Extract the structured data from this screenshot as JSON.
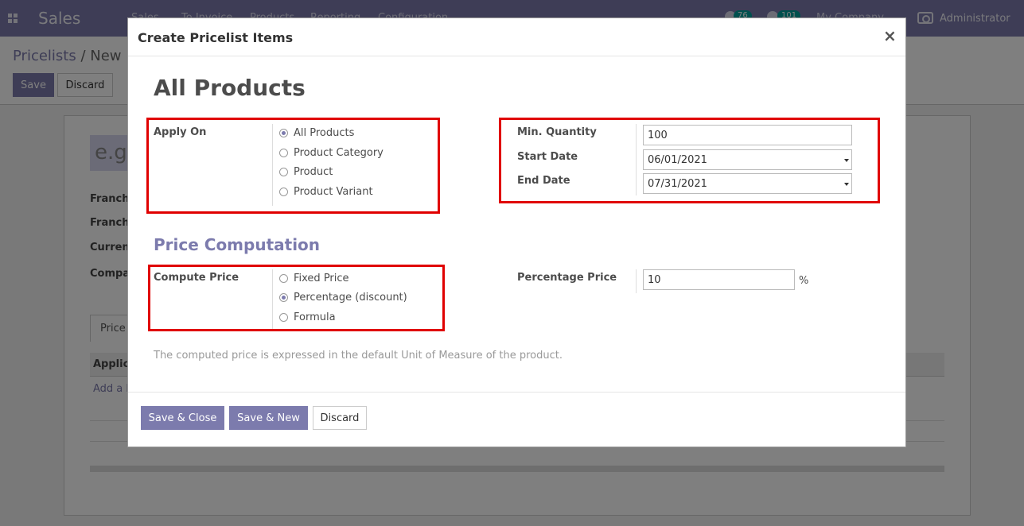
{
  "app": {
    "title": "Sales",
    "nav_items": [
      "Sales",
      "To Invoice",
      "Products",
      "Reporting",
      "Configuration"
    ],
    "activity_count": "76",
    "message_count": "101",
    "company": "My Company",
    "user": "Administrator"
  },
  "background": {
    "breadcrumb_parent": "Pricelists",
    "breadcrumb_sep": " / ",
    "breadcrumb_current": "New",
    "save_label": "Save",
    "discard_label": "Discard",
    "name_placeholder": "e.g.",
    "labels": [
      "Franch",
      "Franch",
      "Curren",
      "Compa"
    ],
    "tab_label": "Price",
    "table_header": "Applic",
    "add_line": "Add a l"
  },
  "modal": {
    "title": "Create Pricelist Items",
    "close_symbol": "×",
    "record_title": "All Products",
    "apply_on": {
      "label": "Apply On",
      "options": [
        {
          "label": "All Products",
          "checked": true
        },
        {
          "label": "Product Category",
          "checked": false
        },
        {
          "label": "Product",
          "checked": false
        },
        {
          "label": "Product Variant",
          "checked": false
        }
      ]
    },
    "min_quantity": {
      "label": "Min. Quantity",
      "value": "100"
    },
    "start_date": {
      "label": "Start Date",
      "value": "06/01/2021"
    },
    "end_date": {
      "label": "End Date",
      "value": "07/31/2021"
    },
    "price_section_title": "Price Computation",
    "compute_price": {
      "label": "Compute Price",
      "options": [
        {
          "label": "Fixed Price",
          "checked": false
        },
        {
          "label": "Percentage (discount)",
          "checked": true
        },
        {
          "label": "Formula",
          "checked": false
        }
      ]
    },
    "percentage_price": {
      "label": "Percentage Price",
      "value": "10",
      "unit": "%"
    },
    "help_text": "The computed price is expressed in the default Unit of Measure of the product.",
    "footer": {
      "save_close": "Save & Close",
      "save_new": "Save & New",
      "discard": "Discard"
    }
  },
  "colors": {
    "brand": "#7c7bad",
    "highlight": "#e00000",
    "badge": "#00a09d"
  }
}
